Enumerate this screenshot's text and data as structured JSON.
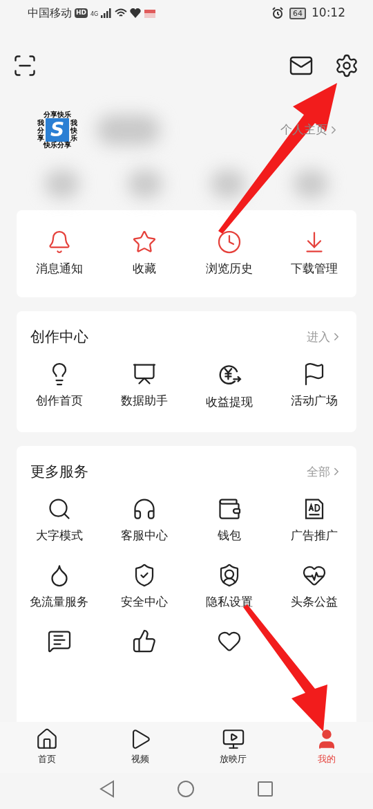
{
  "status_bar": {
    "carrier": "中国移动",
    "hd": "HD",
    "network": "4G",
    "battery": "64",
    "time": "10:12"
  },
  "avatar": {
    "top": "分享快乐",
    "left": "我分享",
    "right": "我快乐",
    "bottom": "快乐分享",
    "letter": "S"
  },
  "profile_link": "个人主页",
  "quick_actions": [
    {
      "label": "消息通知"
    },
    {
      "label": "收藏"
    },
    {
      "label": "浏览历史"
    },
    {
      "label": "下载管理"
    }
  ],
  "creation_center": {
    "title": "创作中心",
    "link": "进入",
    "items": [
      {
        "label": "创作首页"
      },
      {
        "label": "数据助手"
      },
      {
        "label": "收益提现"
      },
      {
        "label": "活动广场"
      }
    ]
  },
  "more_services": {
    "title": "更多服务",
    "link": "全部",
    "items": [
      {
        "label": "大字模式"
      },
      {
        "label": "客服中心"
      },
      {
        "label": "钱包"
      },
      {
        "label": "广告推广"
      },
      {
        "label": "免流量服务"
      },
      {
        "label": "安全中心"
      },
      {
        "label": "隐私设置"
      },
      {
        "label": "头条公益"
      }
    ]
  },
  "bottom_nav": [
    {
      "label": "首页",
      "selected": false
    },
    {
      "label": "视频",
      "selected": false
    },
    {
      "label": "放映厅",
      "selected": false
    },
    {
      "label": "我的",
      "selected": true
    }
  ]
}
